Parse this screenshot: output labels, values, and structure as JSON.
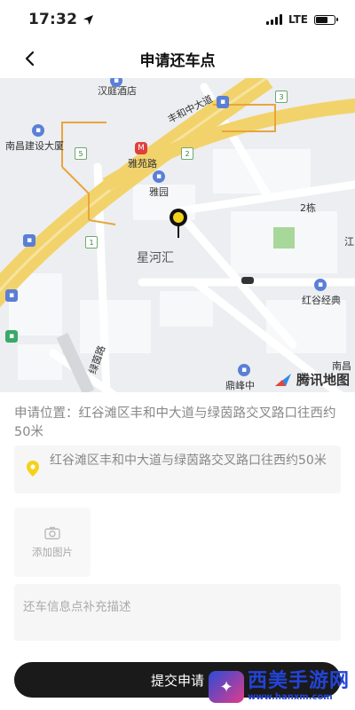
{
  "status": {
    "time": "17:32",
    "network": "LTE"
  },
  "nav": {
    "title": "申请还车点"
  },
  "map": {
    "labels": {
      "hanting": "汉庭酒店",
      "fenghe_road": "丰和中大道",
      "nanchang_building": "南昌建设大厦",
      "yayuan_road": "雅苑路",
      "yayuan": "雅园",
      "building2": "2栋",
      "xinghehui": "星河汇",
      "honggu_jingdian": "红谷经典",
      "lvyin_road": "绿茵路",
      "dingfeng": "鼎峰中",
      "nanchang_right": "南昌",
      "jiang": "江"
    },
    "road_numbers": [
      "5",
      "2",
      "3",
      "1"
    ],
    "logo_text": "腾讯地图"
  },
  "form": {
    "location_label": "申请位置：",
    "location_value": "红谷滩区丰和中大道与绿茵路交叉路口往西约50米",
    "address_box": "红谷滩区丰和中大道与绿茵路交叉路口往西约50米",
    "upload_label": "添加图片",
    "desc_placeholder": "还车信息点补充描述",
    "submit_label": "提交申请"
  },
  "watermark": {
    "title": "西美手游网",
    "url": "www.hanxm.com"
  },
  "colors": {
    "accent": "#f5d21a",
    "button": "#1a1a1a",
    "road_yellow": "#f2d36b"
  }
}
